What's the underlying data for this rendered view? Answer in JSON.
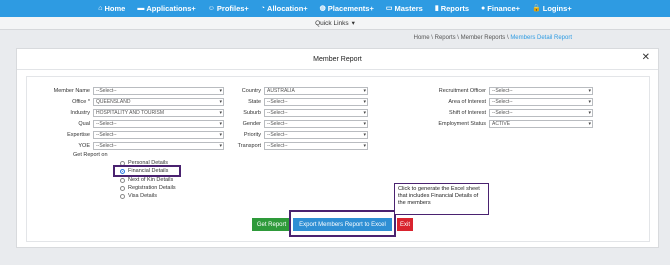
{
  "nav": [
    {
      "label": "Home",
      "icon": "home-icon",
      "glyph": "⌂"
    },
    {
      "label": "Applications+",
      "icon": "folder-icon",
      "glyph": "▬"
    },
    {
      "label": "Profiles+",
      "icon": "users-icon",
      "glyph": "☺"
    },
    {
      "label": "Allocation+",
      "icon": "clock-icon",
      "glyph": "◔"
    },
    {
      "label": "Placements+",
      "icon": "globe-icon",
      "glyph": "◍"
    },
    {
      "label": "Masters",
      "icon": "folders-icon",
      "glyph": "▭"
    },
    {
      "label": "Reports",
      "icon": "chart-icon",
      "glyph": "▮"
    },
    {
      "label": "Finance+",
      "icon": "finance-icon",
      "glyph": "●"
    },
    {
      "label": "Logins+",
      "icon": "lock-icon",
      "glyph": "🔒"
    }
  ],
  "quick_links": {
    "label": "Quick Links",
    "caret": "▾"
  },
  "breadcrumb": {
    "path": "Home \\ Reports \\ Member Reports \\ ",
    "current": "Members Detail Report"
  },
  "panel": {
    "title": "Member Report",
    "close": "✕"
  },
  "fields": {
    "member_name": {
      "label": "Member Name",
      "value": "--Select--"
    },
    "office": {
      "label": "Office *",
      "value": "QUEENSLAND"
    },
    "industry": {
      "label": "Industry",
      "value": "HOSPITALITY AND TOURISM"
    },
    "qual": {
      "label": "Qual",
      "value": "--Select--"
    },
    "expertise": {
      "label": "Expertise",
      "value": "--Select--"
    },
    "yoe": {
      "label": "YOE",
      "value": "--Select--"
    },
    "country": {
      "label": "Country",
      "value": "AUSTRALIA"
    },
    "state": {
      "label": "State",
      "value": "--Select--"
    },
    "suburb": {
      "label": "Suburb",
      "value": "--Select--"
    },
    "gender": {
      "label": "Gender",
      "value": "--Select--"
    },
    "priority": {
      "label": "Priority",
      "value": "--Select--"
    },
    "transport": {
      "label": "Transport",
      "value": "--Select--"
    },
    "recruitment_officer": {
      "label": "Recruitment Officer",
      "value": "--Select--"
    },
    "area_of_interest": {
      "label": "Area of Interest",
      "value": "--Select--"
    },
    "shift_of_interest": {
      "label": "Shift of Interest",
      "value": "--Select--"
    },
    "employment_status": {
      "label": "Employment Status",
      "value": "ACTIVE"
    }
  },
  "report_on": {
    "label": "Get Report on",
    "options": [
      "Personal Details",
      "Financial Details",
      "Next of Kin Details",
      "Registration Details",
      "Visa Details"
    ],
    "selected": "Financial Details"
  },
  "buttons": {
    "get_report": "Get Report",
    "export": "Export Members Report to Excel",
    "exit": "Exit"
  },
  "callout": "Click to generate the Excel sheet that includes Financial Details of the members",
  "colors": {
    "nav": "#2e9be2",
    "get_report": "#2e9a3a",
    "export": "#2e8fd4",
    "exit": "#d9232e",
    "highlight": "#4a2270"
  }
}
